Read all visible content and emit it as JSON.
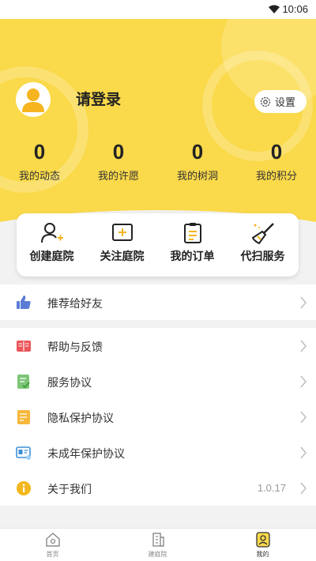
{
  "status_bar": {
    "time": "10:06"
  },
  "profile": {
    "login_text": "请登录",
    "settings_label": "设置"
  },
  "stats": [
    {
      "value": "0",
      "label": "我的动态"
    },
    {
      "value": "0",
      "label": "我的许愿"
    },
    {
      "value": "0",
      "label": "我的树洞"
    },
    {
      "value": "0",
      "label": "我的积分"
    }
  ],
  "actions": [
    {
      "label": "创建庭院",
      "icon": "user-add-icon"
    },
    {
      "label": "关注庭院",
      "icon": "add-box-icon"
    },
    {
      "label": "我的订单",
      "icon": "clipboard-icon"
    },
    {
      "label": "代扫服务",
      "icon": "broom-icon"
    }
  ],
  "menu_group_1": [
    {
      "label": "推荐给好友",
      "icon": "thumbs-up-icon"
    }
  ],
  "menu_group_2": [
    {
      "label": "帮助与反馈",
      "icon": "book-icon"
    },
    {
      "label": "服务协议",
      "icon": "document-check-icon"
    },
    {
      "label": "隐私保护协议",
      "icon": "privacy-doc-icon"
    },
    {
      "label": "未成年保护协议",
      "icon": "id-card-icon"
    },
    {
      "label": "关于我们",
      "icon": "info-icon",
      "value": "1.0.17"
    }
  ],
  "tabbar": [
    {
      "label": "首页",
      "icon": "home-icon"
    },
    {
      "label": "建庭院",
      "icon": "building-icon"
    },
    {
      "label": "我的",
      "icon": "profile-icon",
      "active": true
    }
  ],
  "colors": {
    "brand_yellow": "#fad94a",
    "thumb_blue": "#5b7bd5",
    "book_red": "#e9555a",
    "doc_green": "#7cc576",
    "privacy_orange": "#f6b73c",
    "info_yellow": "#f3b71d"
  }
}
